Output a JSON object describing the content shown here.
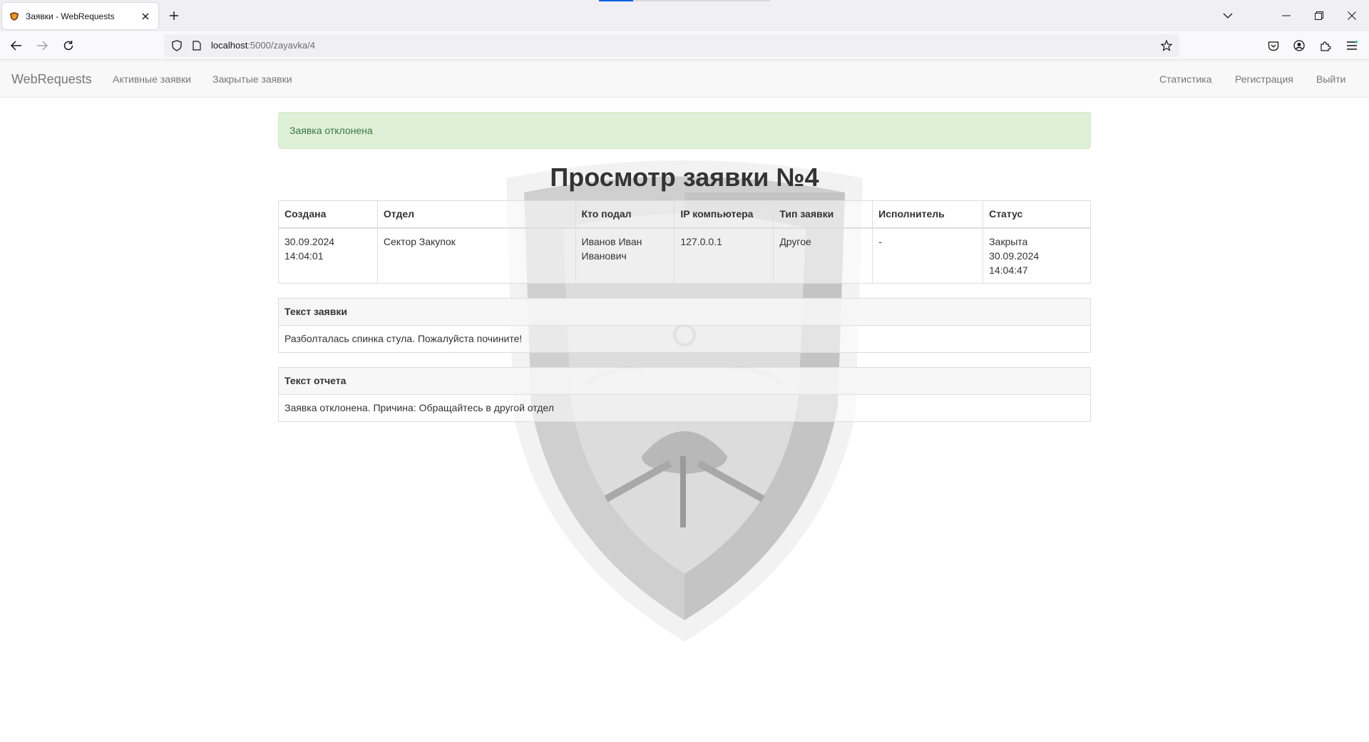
{
  "browser": {
    "tab_title": "Заявки - WebRequests",
    "url_host": "localhost",
    "url_path": ":5000/zayavka/4"
  },
  "site": {
    "brand": "WebRequests",
    "nav_left": [
      "Активные заявки",
      "Закрытые заявки"
    ],
    "nav_right": [
      "Статистика",
      "Регистрация",
      "Выйти"
    ]
  },
  "alert": "Заявка отклонена",
  "title": "Просмотр заявки №4",
  "table": {
    "headers": [
      "Создана",
      "Отдел",
      "Кто подал",
      "IP компьютера",
      "Тип заявки",
      "Исполнитель",
      "Статус"
    ],
    "row": {
      "created_date": "30.09.2024",
      "created_time": "14:04:01",
      "department": "Сектор Закупок",
      "author_line1": "Иванов Иван",
      "author_line2": "Иванович",
      "ip": "127.0.0.1",
      "type": "Другое",
      "executor": "-",
      "status_line1": "Закрыта",
      "status_line2": "30.09.2024",
      "status_line3": "14:04:47"
    }
  },
  "request_text": {
    "heading": "Текст заявки",
    "body": "Разболталась спинка стула. Пожалуйста почините!"
  },
  "report_text": {
    "heading": "Текст отчета",
    "body": "Заявка отклонена. Причина: Обращайтесь в другой отдел"
  }
}
